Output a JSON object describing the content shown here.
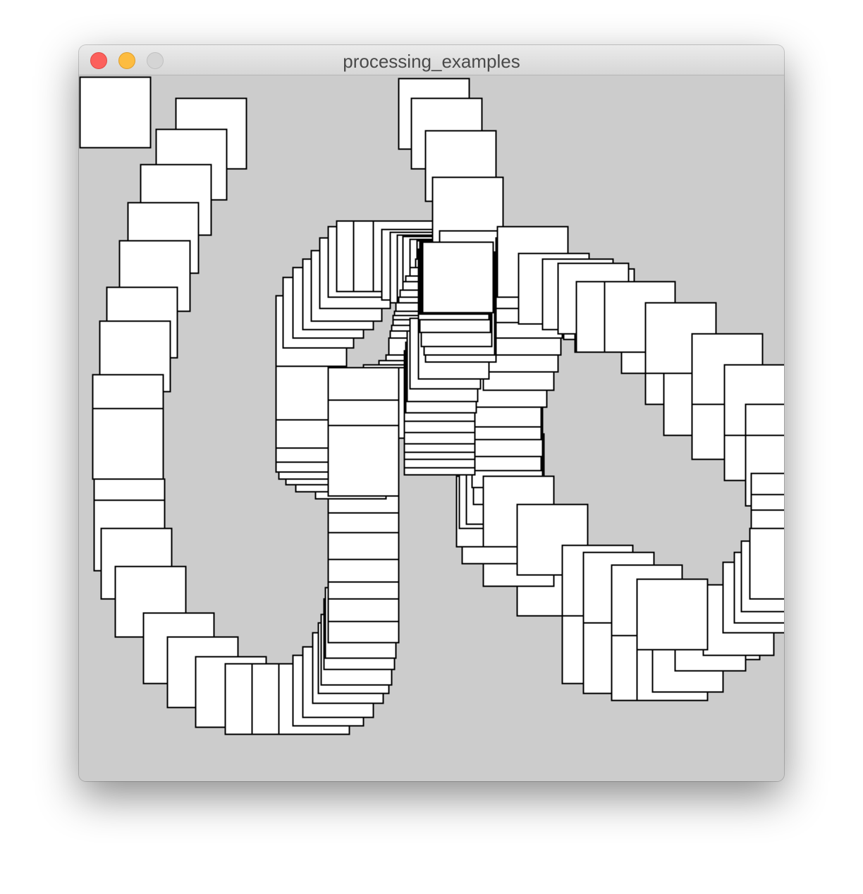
{
  "window": {
    "title": "processing_examples",
    "controls": {
      "close": "close-button",
      "minimize": "minimize-button",
      "zoom": "zoom-button"
    }
  },
  "sketch": {
    "background_color": "#cccccc",
    "square_fill": "#ffffff",
    "square_stroke": "#000000",
    "description_icon": "trail-of-squares"
  }
}
